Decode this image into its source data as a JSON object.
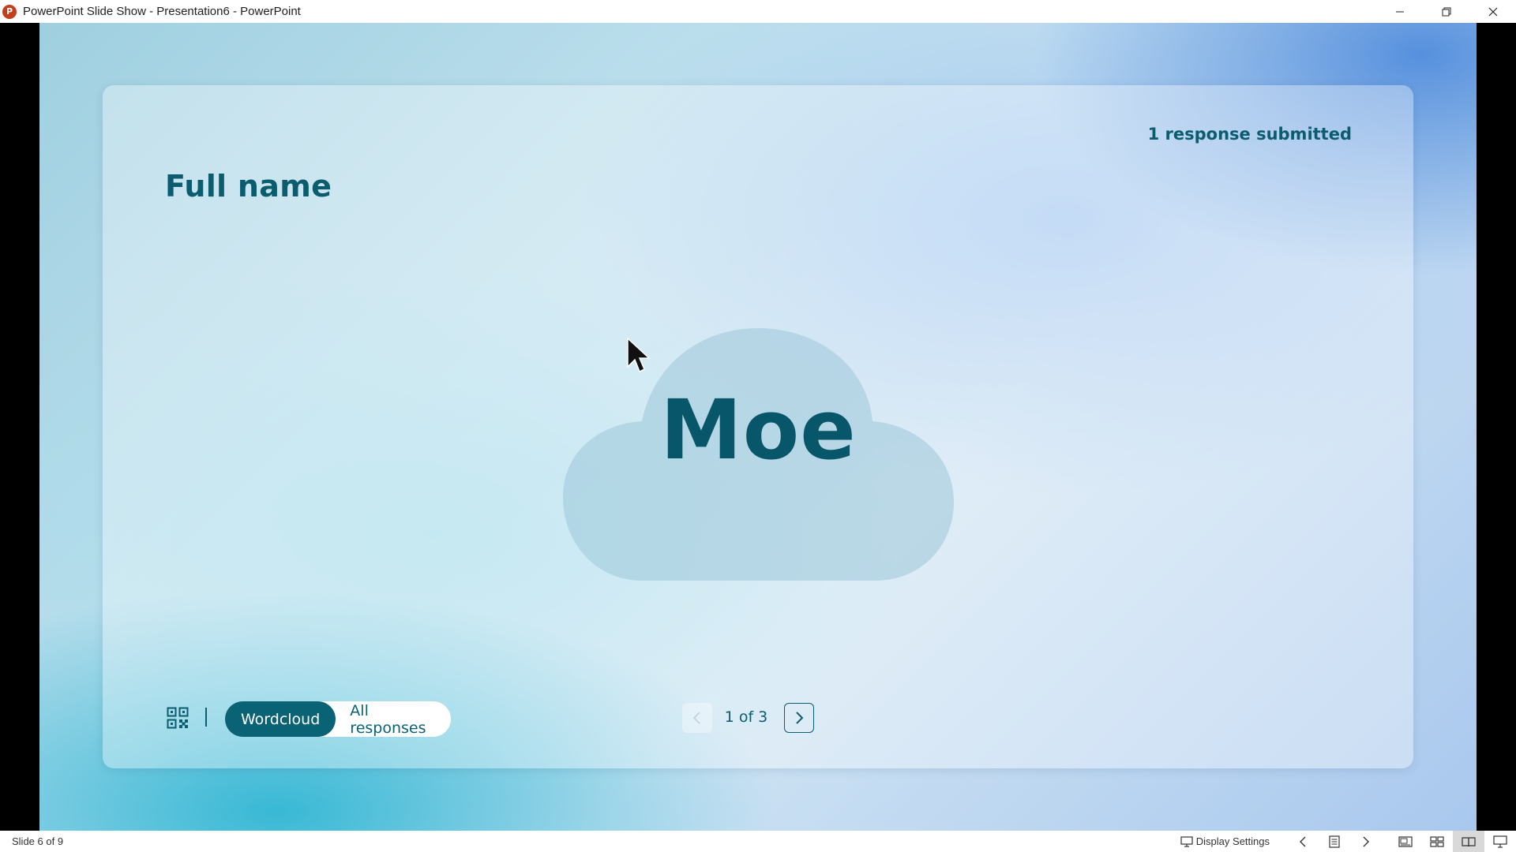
{
  "window": {
    "title": "PowerPoint Slide Show  -  Presentation6 - PowerPoint",
    "app_icon": "powerpoint-icon",
    "app_icon_letter": "P",
    "controls": [
      "minimize-icon",
      "restore-icon",
      "close-icon"
    ]
  },
  "slide": {
    "question": "Full name",
    "response_count": "1 response submitted",
    "wordcloud": {
      "words": [
        "Moe"
      ]
    },
    "controls": {
      "qr_icon": "qr-code-icon",
      "view_toggle": {
        "active": "Wordcloud",
        "inactive": "All responses"
      },
      "pager": {
        "text": "1 of 3",
        "prev_icon": "chevron-left-icon",
        "next_icon": "chevron-right-icon"
      }
    },
    "colors": {
      "accent": "#0a6275",
      "text": "#0b5c6e"
    }
  },
  "statusbar": {
    "slide_counter": "Slide 6 of 9",
    "display_settings": "Display Settings"
  }
}
